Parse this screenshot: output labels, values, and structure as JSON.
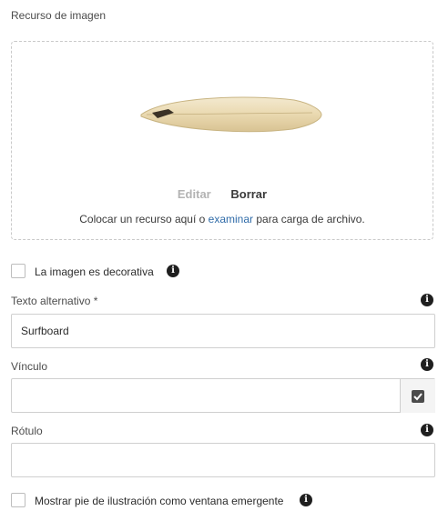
{
  "image_asset": {
    "label": "Recurso de imagen",
    "edit_label": "Editar",
    "delete_label": "Borrar",
    "drop_hint_before": "Colocar un recurso aquí o ",
    "drop_hint_link": "examinar",
    "drop_hint_after": " para carga de archivo."
  },
  "decorative": {
    "label": "La imagen es decorativa",
    "checked": false
  },
  "alt_text": {
    "label": "Texto alternativo *",
    "value": "Surfboard"
  },
  "link": {
    "label": "Vínculo",
    "value": ""
  },
  "caption": {
    "label": "Rótulo",
    "value": ""
  },
  "popup_caption": {
    "label": "Mostrar pie de ilustración como ventana emergente",
    "checked": false
  },
  "icons": {
    "info": "info-icon",
    "picker": "checkbox-picker-icon"
  },
  "colors": {
    "link": "#2f6ba8",
    "info_icon": "#1f1f1f"
  }
}
